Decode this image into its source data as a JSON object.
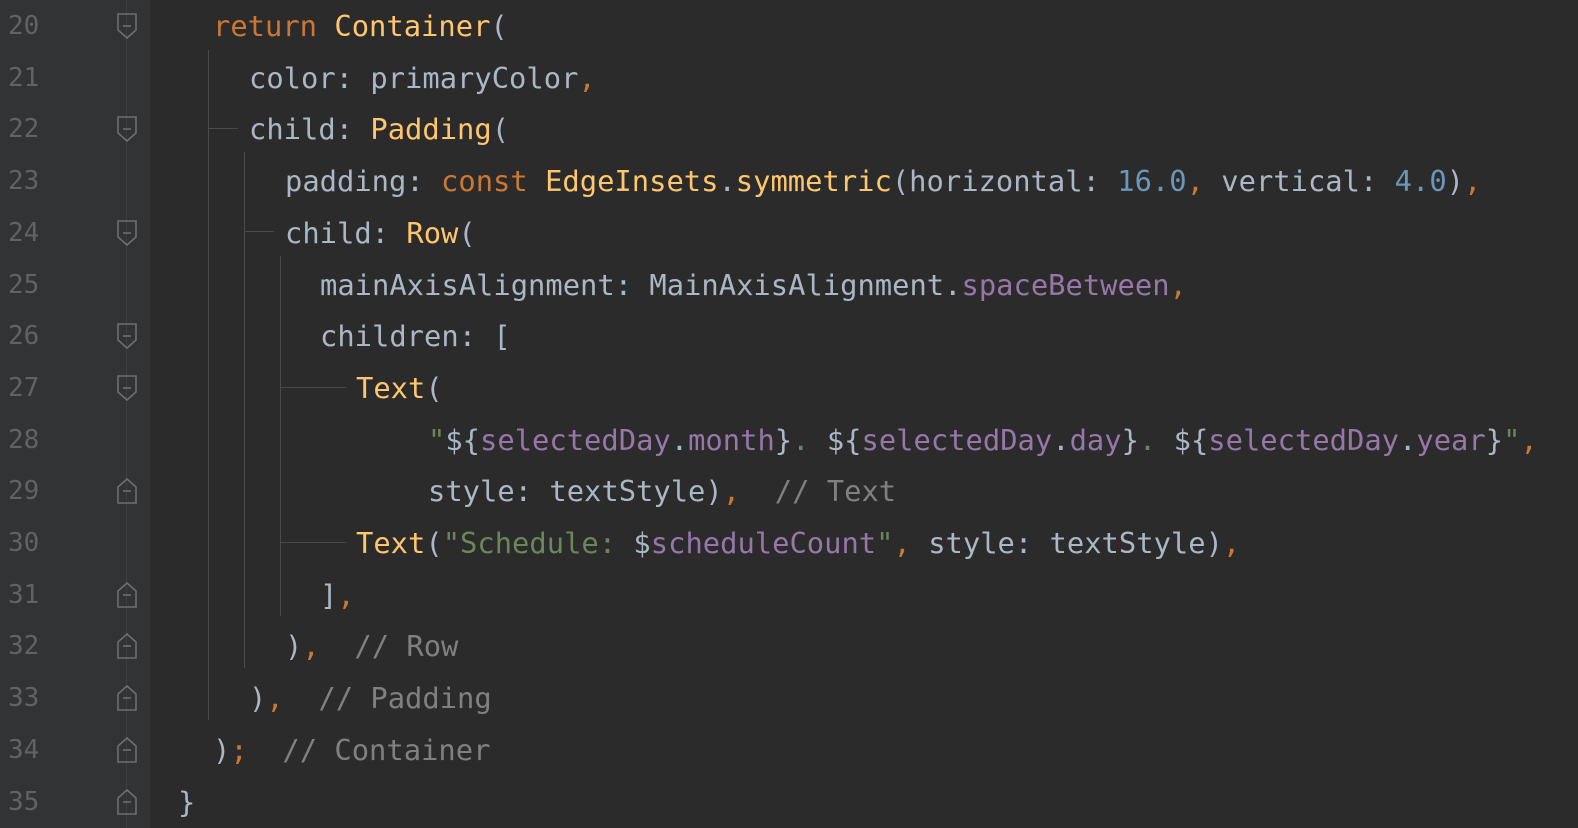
{
  "editor": {
    "colors": {
      "background": "#2b2b2b",
      "gutter": "#313335",
      "line_number": "#606366",
      "default": "#a9b7c6",
      "keyword": "#cc7832",
      "class": "#ffc66d",
      "property": "#9876aa",
      "number": "#6897bb",
      "string": "#6a8759",
      "comment": "#808080"
    },
    "lines": [
      {
        "number": "20",
        "fold": "fold-open-icon",
        "tokens": [
          {
            "t": "kw",
            "v": "return "
          },
          {
            "t": "cls",
            "v": "Container"
          },
          {
            "t": "id",
            "v": "("
          }
        ]
      },
      {
        "number": "21",
        "fold": "",
        "tokens": [
          {
            "t": "id",
            "v": "color: primaryColor"
          },
          {
            "t": "punc",
            "v": ","
          }
        ]
      },
      {
        "number": "22",
        "fold": "fold-open-icon",
        "tokens": [
          {
            "t": "id",
            "v": "child: "
          },
          {
            "t": "cls",
            "v": "Padding"
          },
          {
            "t": "id",
            "v": "("
          }
        ]
      },
      {
        "number": "23",
        "fold": "",
        "tokens": [
          {
            "t": "id",
            "v": "padding: "
          },
          {
            "t": "kw",
            "v": "const "
          },
          {
            "t": "cls",
            "v": "EdgeInsets"
          },
          {
            "t": "id",
            "v": "."
          },
          {
            "t": "cls",
            "v": "symmetric"
          },
          {
            "t": "id",
            "v": "(horizontal: "
          },
          {
            "t": "num",
            "v": "16.0"
          },
          {
            "t": "punc",
            "v": ", "
          },
          {
            "t": "id",
            "v": "vertical: "
          },
          {
            "t": "num",
            "v": "4.0"
          },
          {
            "t": "id",
            "v": ")"
          },
          {
            "t": "punc",
            "v": ","
          }
        ]
      },
      {
        "number": "24",
        "fold": "fold-open-icon",
        "tokens": [
          {
            "t": "id",
            "v": "child: "
          },
          {
            "t": "cls",
            "v": "Row"
          },
          {
            "t": "id",
            "v": "("
          }
        ]
      },
      {
        "number": "25",
        "fold": "",
        "tokens": [
          {
            "t": "id",
            "v": "mainAxisAlignment: MainAxisAlignment."
          },
          {
            "t": "prop",
            "v": "spaceBetween"
          },
          {
            "t": "punc",
            "v": ","
          }
        ]
      },
      {
        "number": "26",
        "fold": "fold-open-icon",
        "tokens": [
          {
            "t": "id",
            "v": "children: ["
          }
        ]
      },
      {
        "number": "27",
        "fold": "fold-open-icon",
        "tokens": [
          {
            "t": "cls",
            "v": "Text"
          },
          {
            "t": "id",
            "v": "("
          }
        ]
      },
      {
        "number": "28",
        "fold": "",
        "tokens": [
          {
            "t": "str",
            "v": "\""
          },
          {
            "t": "id",
            "v": "${"
          },
          {
            "t": "prop",
            "v": "selectedDay"
          },
          {
            "t": "id",
            "v": "."
          },
          {
            "t": "prop",
            "v": "month"
          },
          {
            "t": "id",
            "v": "}"
          },
          {
            "t": "str",
            "v": ". "
          },
          {
            "t": "id",
            "v": "${"
          },
          {
            "t": "prop",
            "v": "selectedDay"
          },
          {
            "t": "id",
            "v": "."
          },
          {
            "t": "prop",
            "v": "day"
          },
          {
            "t": "id",
            "v": "}"
          },
          {
            "t": "str",
            "v": ". "
          },
          {
            "t": "id",
            "v": "${"
          },
          {
            "t": "prop",
            "v": "selectedDay"
          },
          {
            "t": "id",
            "v": "."
          },
          {
            "t": "prop",
            "v": "year"
          },
          {
            "t": "id",
            "v": "}"
          },
          {
            "t": "str",
            "v": "\""
          },
          {
            "t": "punc",
            "v": ","
          }
        ]
      },
      {
        "number": "29",
        "fold": "fold-close-icon",
        "tokens": [
          {
            "t": "id",
            "v": "style: textStyle)"
          },
          {
            "t": "punc",
            "v": ","
          },
          {
            "t": "com",
            "v": "  // Text"
          }
        ]
      },
      {
        "number": "30",
        "fold": "",
        "tokens": [
          {
            "t": "cls",
            "v": "Text"
          },
          {
            "t": "id",
            "v": "("
          },
          {
            "t": "str",
            "v": "\"Schedule: "
          },
          {
            "t": "id",
            "v": "$"
          },
          {
            "t": "prop",
            "v": "scheduleCount"
          },
          {
            "t": "str",
            "v": "\""
          },
          {
            "t": "punc",
            "v": ", "
          },
          {
            "t": "id",
            "v": "style: textStyle)"
          },
          {
            "t": "punc",
            "v": ","
          }
        ]
      },
      {
        "number": "31",
        "fold": "fold-close-icon",
        "tokens": [
          {
            "t": "id",
            "v": "]"
          },
          {
            "t": "punc",
            "v": ","
          }
        ]
      },
      {
        "number": "32",
        "fold": "fold-close-icon",
        "tokens": [
          {
            "t": "id",
            "v": ")"
          },
          {
            "t": "punc",
            "v": ","
          },
          {
            "t": "com",
            "v": "  // Row"
          }
        ]
      },
      {
        "number": "33",
        "fold": "fold-close-icon",
        "tokens": [
          {
            "t": "id",
            "v": ")"
          },
          {
            "t": "punc",
            "v": ","
          },
          {
            "t": "com",
            "v": "  // Padding"
          }
        ]
      },
      {
        "number": "34",
        "fold": "fold-close-icon",
        "tokens": [
          {
            "t": "id",
            "v": ")"
          },
          {
            "t": "punc",
            "v": ";"
          },
          {
            "t": "com",
            "v": "  // Container"
          }
        ]
      },
      {
        "number": "35",
        "fold": "fold-close-icon",
        "tokens": [
          {
            "t": "id",
            "v": "}"
          }
        ]
      }
    ]
  }
}
